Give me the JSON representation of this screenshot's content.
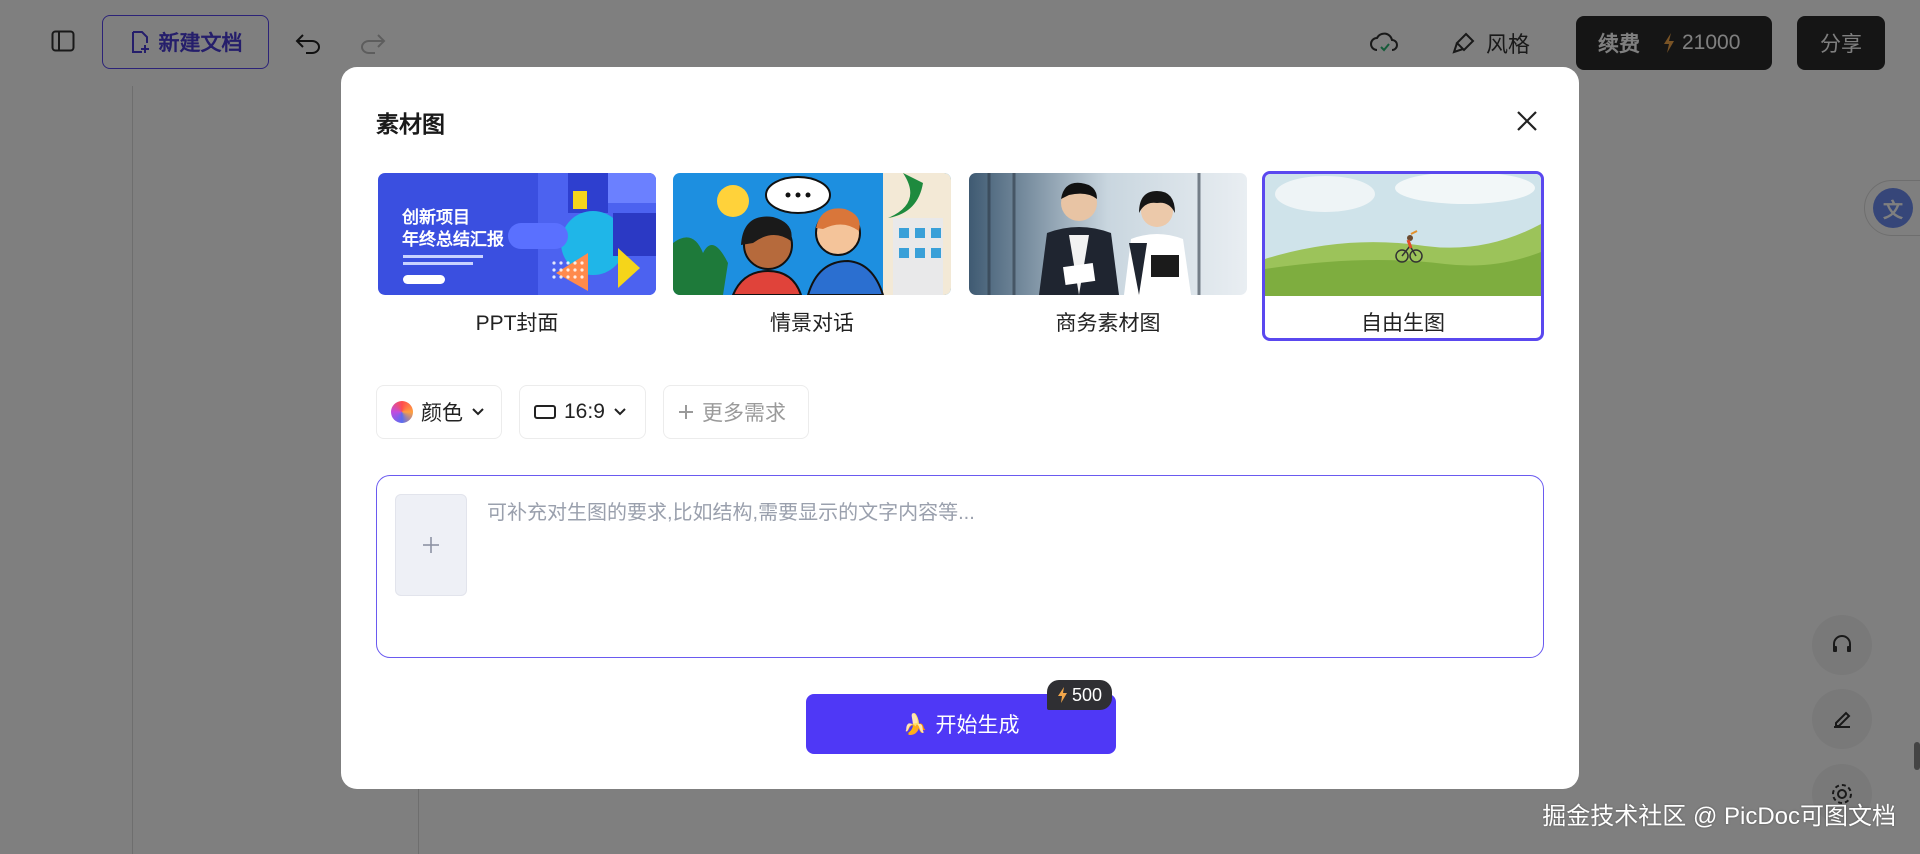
{
  "toolbar": {
    "new_doc_label": "新建文档",
    "style_label": "风格",
    "renew_label": "续费",
    "credits": "21000",
    "share_label": "分享"
  },
  "modal": {
    "title": "素材图",
    "cards": [
      {
        "label": "PPT封面",
        "selected": false
      },
      {
        "label": "情景对话",
        "selected": false
      },
      {
        "label": "商务素材图",
        "selected": false
      },
      {
        "label": "自由生图",
        "selected": true
      }
    ],
    "ppt_thumb": {
      "line1": "创新项目",
      "line2": "年终总结汇报"
    },
    "options": {
      "color_label": "颜色",
      "ratio_label": "16:9",
      "more_label": "更多需求"
    },
    "prompt": {
      "value": "",
      "placeholder": "可补充对生图的要求,比如结构,需要显示的文字内容等..."
    },
    "generate_label": "开始生成",
    "cost": "500"
  },
  "watermark": "掘金技术社区 @ PicDoc可图文档",
  "colors": {
    "accent": "#4f38f6",
    "selected_border": "#5a48ef",
    "dark_button": "#2b2b2b"
  }
}
